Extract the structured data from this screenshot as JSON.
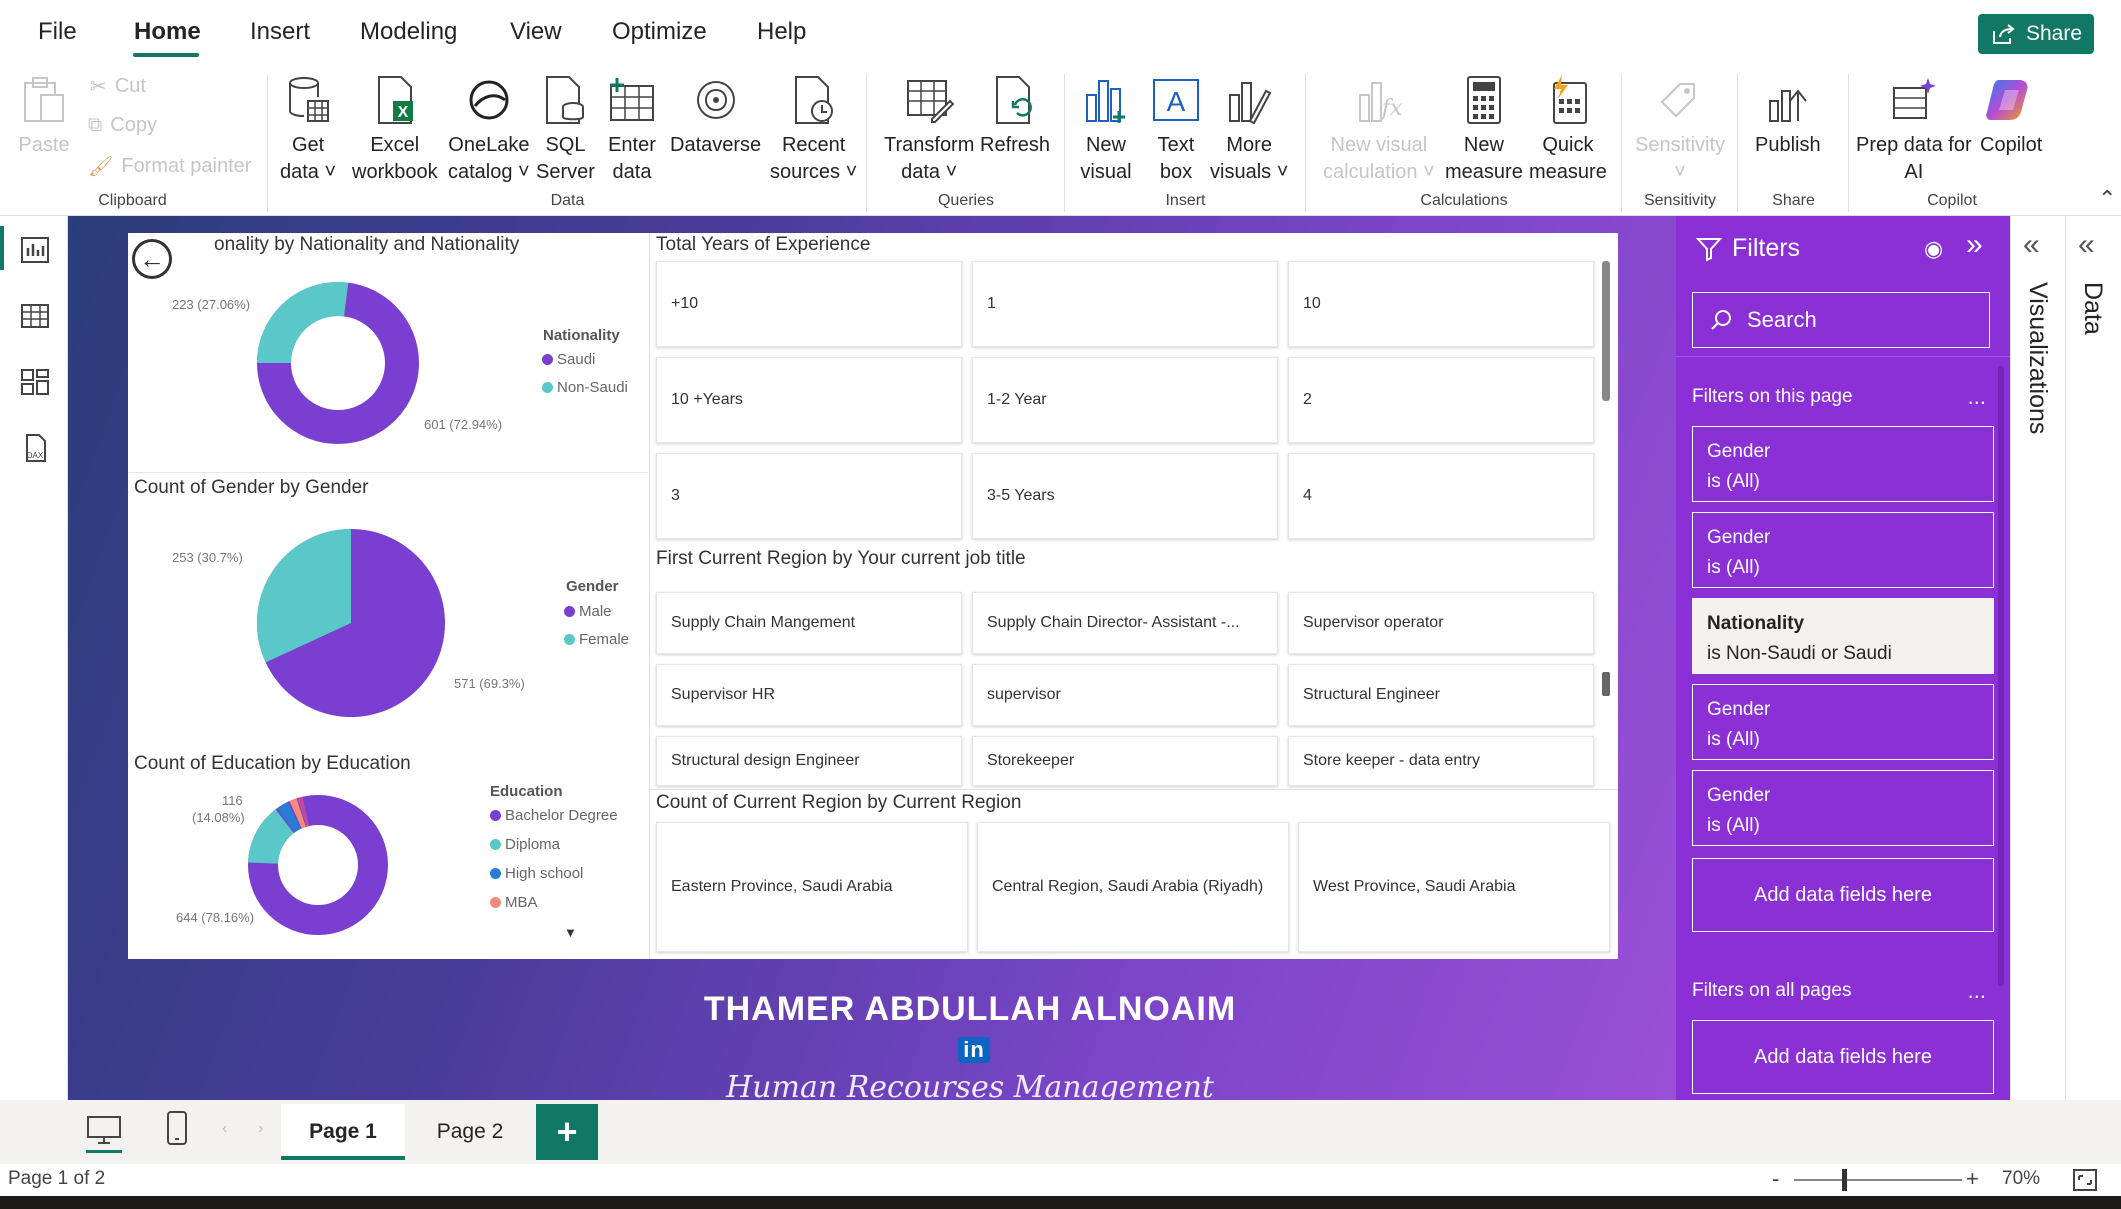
{
  "menu": {
    "items": [
      "File",
      "Home",
      "Insert",
      "Modeling",
      "View",
      "Optimize",
      "Help"
    ],
    "active": "Home",
    "share": "Share"
  },
  "ribbon": {
    "clipboard": {
      "paste": "Paste",
      "cut": "Cut",
      "copy": "Copy",
      "format_painter": "Format painter",
      "label": "Clipboard"
    },
    "data": {
      "get_data": [
        "Get",
        "data ˅"
      ],
      "excel": [
        "Excel",
        "workbook"
      ],
      "onelake": [
        "OneLake",
        "catalog ˅"
      ],
      "sql": [
        "SQL",
        "Server"
      ],
      "enter": [
        "Enter",
        "data"
      ],
      "dataverse": [
        "Dataverse",
        ""
      ],
      "recent": [
        "Recent",
        "sources ˅"
      ],
      "label": "Data"
    },
    "queries": {
      "transform": [
        "Transform",
        "data ˅"
      ],
      "refresh": [
        "Refresh",
        ""
      ],
      "label": "Queries"
    },
    "insert": {
      "new_visual": [
        "New",
        "visual"
      ],
      "text_box": [
        "Text",
        "box"
      ],
      "more_visuals": [
        "More",
        "visuals ˅"
      ],
      "label": "Insert"
    },
    "calculations": {
      "new_calc": [
        "New visual",
        "calculation ˅"
      ],
      "new_measure": [
        "New",
        "measure"
      ],
      "quick_measure": [
        "Quick",
        "measure"
      ],
      "label": "Calculations"
    },
    "sensitivity": {
      "sensitivity": [
        "Sensitivity",
        "˅"
      ],
      "label": "Sensitivity"
    },
    "share": {
      "publish": [
        "Publish",
        ""
      ],
      "label": "Share"
    },
    "copilot": {
      "prep": [
        "Prep data for",
        "AI"
      ],
      "copilot": [
        "Copilot",
        ""
      ],
      "label": "Copilot"
    }
  },
  "report": {
    "nationality_chart": {
      "title": "onality by Nationality and Nationality",
      "legend_title": "Nationality",
      "legend": [
        "Saudi",
        "Non-Saudi"
      ],
      "label_small": "223 (27.06%)",
      "label_large": "601 (72.94%)"
    },
    "gender_chart": {
      "title": "Count of Gender by Gender",
      "legend_title": "Gender",
      "legend": [
        "Male",
        "Female"
      ],
      "label_small": "253 (30.7%)",
      "label_large": "571 (69.3%)"
    },
    "education_chart": {
      "title": "Count of Education by Education",
      "legend_title": "Education",
      "legend": [
        "Bachelor Degree",
        "Diploma",
        "High school",
        "MBA"
      ],
      "label_small_1": "116",
      "label_small_2": "(14.08%)",
      "label_large": "644 (78.16%)"
    },
    "experience": {
      "title": "Total Years of Experience",
      "cells": [
        "+10",
        "1",
        "10",
        "10 +Years",
        "1-2 Year",
        "2",
        "3",
        "3-5 Years",
        "4"
      ]
    },
    "region_job": {
      "title": "First Current Region by Your current job title",
      "cells": [
        "Supply Chain Mangement",
        "Supply Chain Director- Assistant -...",
        "Supervisor operator",
        "Supervisor HR",
        "supervisor",
        "Structural Engineer",
        "Structural design Engineer",
        "Storekeeper",
        "Store keeper - data entry"
      ]
    },
    "region_count": {
      "title": "Count of Current Region by Current Region",
      "cells": [
        "Eastern Province, Saudi Arabia",
        "Central Region, Saudi Arabia (Riyadh)",
        "West Province, Saudi Arabia"
      ]
    },
    "signature": {
      "name": "THAMER ABDULLAH ALNOAIM",
      "badge": "in",
      "role": "Human Recourses Management"
    }
  },
  "filters": {
    "title": "Filters",
    "search_placeholder": "Search",
    "on_page": "Filters on this page",
    "more": "...",
    "cards": [
      {
        "field": "Gender",
        "state": "is (All)"
      },
      {
        "field": "Gender",
        "state": "is (All)"
      },
      {
        "field": "Nationality",
        "state": "is Non-Saudi or Saudi"
      },
      {
        "field": "Gender",
        "state": "is (All)"
      },
      {
        "field": "Gender",
        "state": "is (All)"
      }
    ],
    "add": "Add data fields here",
    "on_all": "Filters on all pages"
  },
  "panes": {
    "visualizations": "Visualizations",
    "data": "Data"
  },
  "tabs": {
    "page1": "Page 1",
    "page2": "Page 2",
    "add": "+"
  },
  "status": {
    "page": "Page 1 of 2",
    "zoom": "70%",
    "minus": "-",
    "plus": "+"
  },
  "colors": {
    "accent": "#117865",
    "purple": "#7a3fd0",
    "teal": "#5ac8c8",
    "blue": "#2a7bd4",
    "salmon": "#f28b7b",
    "filters_bg": "#8b2fd6"
  }
}
